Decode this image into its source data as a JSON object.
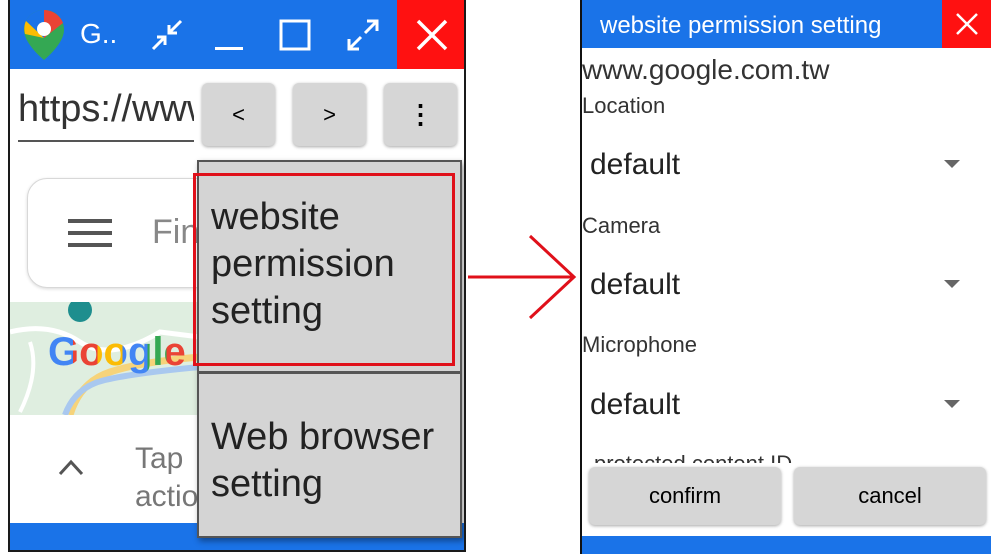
{
  "left_window": {
    "title": "G..",
    "url": "https://www.google.com.tw",
    "back_label": "<",
    "forward_label": ">",
    "menu_label": "⋮",
    "search_placeholder": "Fin",
    "map_logo_text": "Google",
    "bottom_hint_line1": "Tap",
    "bottom_hint_line2": "actio",
    "popup_menu": {
      "items": [
        {
          "label_line1": "website",
          "label_line2": "permission",
          "label_line3": "setting"
        },
        {
          "label_line1": "Web browser",
          "label_line2": "setting"
        }
      ]
    }
  },
  "dialog": {
    "title": "website permission setting",
    "domain": "www.google.com.tw",
    "permissions": [
      {
        "label": "Location",
        "value": "default"
      },
      {
        "label": "Camera",
        "value": "default"
      },
      {
        "label": "Microphone",
        "value": "default"
      }
    ],
    "partially_hidden_label": "protected content ID",
    "confirm_label": "confirm",
    "cancel_label": "cancel"
  },
  "colors": {
    "titlebar_blue": "#1a73e8",
    "close_red": "#ff1111",
    "highlight_red": "#e0101a",
    "button_gray": "#d6d6d6"
  },
  "icons": [
    "google-maps-icon",
    "minimize-arrows-icon",
    "minimize-icon",
    "maximize-icon",
    "fullscreen-icon",
    "close-icon",
    "hamburger-menu-icon",
    "chevron-up-icon",
    "dropdown-arrow-icon",
    "right-arrow-icon"
  ]
}
